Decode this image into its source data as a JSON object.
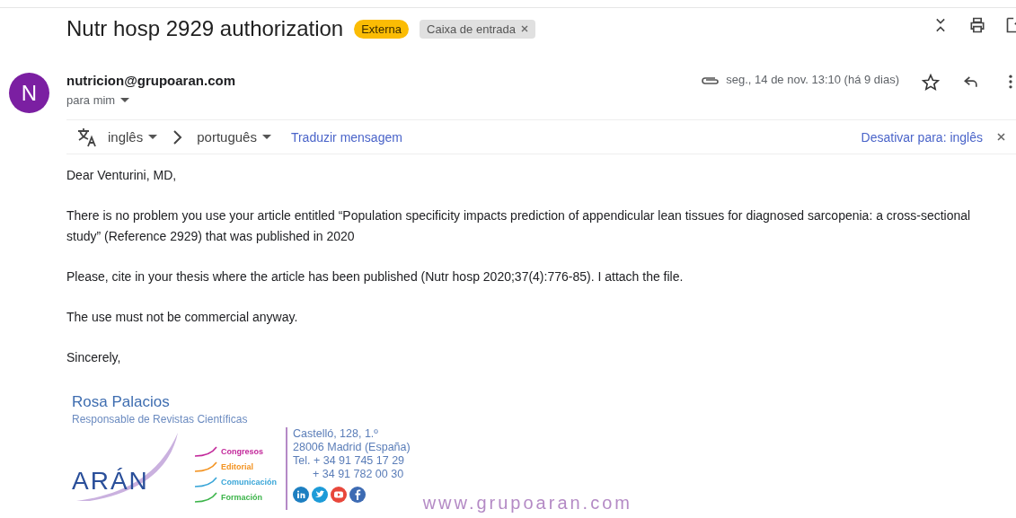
{
  "subject": "Nutr hosp 2929 authorization",
  "labels": [
    {
      "text": "Externa",
      "kind": "tag",
      "removable": false
    },
    {
      "text": "Caixa de entrada",
      "kind": "folder",
      "removable": true
    }
  ],
  "sender": {
    "initial": "N",
    "color": "#7b1fa2",
    "email": "nutricion@grupoaran.com",
    "to": "para mim"
  },
  "date": "seg., 14 de nov. 13:10 (há 9 dias)",
  "has_attachment": true,
  "starred": false,
  "translate": {
    "from": "inglês",
    "to": "português",
    "action": "Traduzir mensagem",
    "disable": "Desativar para: inglês"
  },
  "body": [
    {
      "text": "Dear Venturini, MD,"
    },
    {
      "text": "There is no problem you use your article entitled “Population specificity impacts prediction of appendicular lean tissues for diagnosed sarcopenia: a cross-sectional study” (Reference 2929) that was published in 2020"
    },
    {
      "text": "Please, cite in your thesis where the article has been published (Nutr hosp 2020;37(4):776-85). I attach the file."
    },
    {
      "text": "The use must not be commercial anyway."
    },
    {
      "text": "Sincerely,"
    }
  ],
  "signature": {
    "name": "Rosa Palacios",
    "role": "Responsable de Revistas Científicas",
    "logo": "ARÁN",
    "divisions": [
      {
        "text": "Congresos",
        "color": "#c2279a"
      },
      {
        "text": "Editorial",
        "color": "#f39321"
      },
      {
        "text": "Comunicación",
        "color": "#3aa6d8"
      },
      {
        "text": "Formación",
        "color": "#3cb44a"
      }
    ],
    "address": [
      "Castelló, 128, 1.º",
      "28006 Madrid (España)",
      "Tel. + 34 91 745 17 29",
      "+ 34 91 782 00 30"
    ],
    "social": [
      {
        "kind": "linkedin",
        "color": "#1d7fc1"
      },
      {
        "kind": "twitter",
        "color": "#1d9bd8"
      },
      {
        "kind": "youtube",
        "color": "#e8473b"
      },
      {
        "kind": "facebook",
        "color": "#3d6bb3"
      }
    ],
    "website": "www.grupoaran.com"
  }
}
